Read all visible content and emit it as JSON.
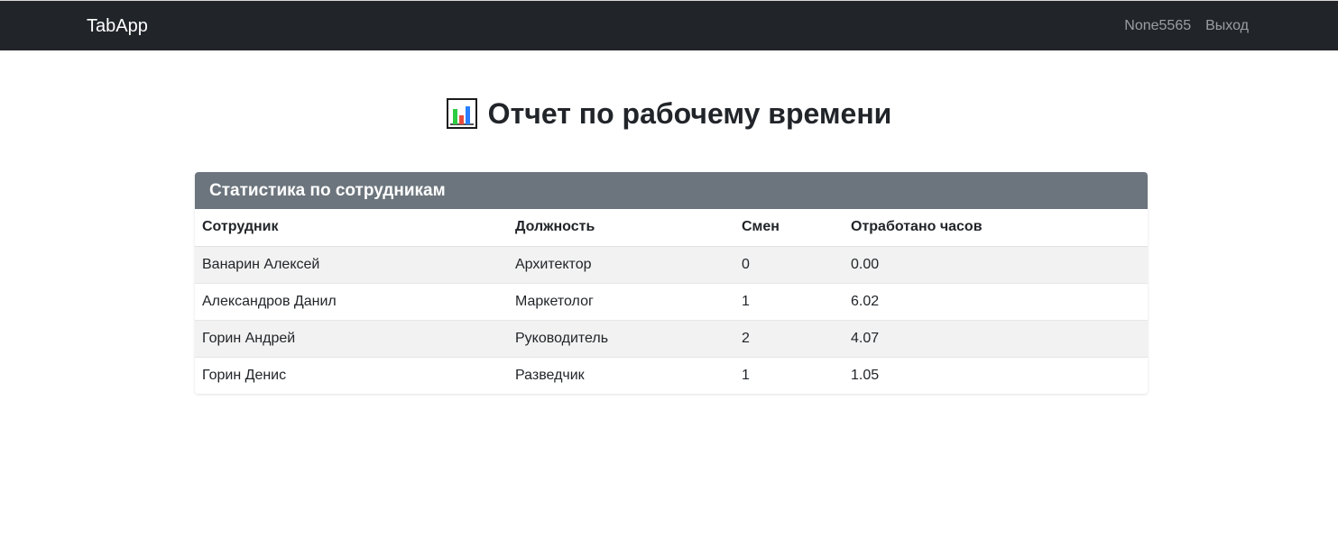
{
  "navbar": {
    "brand": "TabApp",
    "username": "None5565",
    "logout": "Выход"
  },
  "page": {
    "title": "Отчет по рабочему времени",
    "title_icon": "bar-chart-icon"
  },
  "card": {
    "header": "Статистика по сотрудникам",
    "columns": [
      "Сотрудник",
      "Должность",
      "Смен",
      "Отработано часов"
    ],
    "rows": [
      [
        "Ванарин Алексей",
        "Архитектор",
        "0",
        "0.00"
      ],
      [
        "Александров Данил",
        "Маркетолог",
        "1",
        "6.02"
      ],
      [
        "Горин Андрей",
        "Руководитель",
        "2",
        "4.07"
      ],
      [
        "Горин Денис",
        "Разведчик",
        "1",
        "1.05"
      ]
    ]
  },
  "colors": {
    "navbar": "#212529",
    "card_header": "#6c757d",
    "striped_row": "#f2f2f2"
  }
}
